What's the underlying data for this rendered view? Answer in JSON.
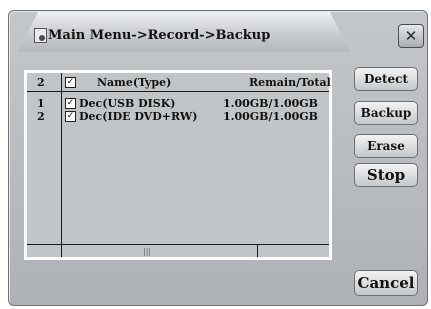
{
  "window": {
    "title": "Main Menu->Record->Backup",
    "close_label": "✕"
  },
  "list": {
    "header": {
      "count": "2",
      "name": "Name(Type)",
      "remain": "Remain/Total"
    },
    "rows": [
      {
        "index": "1",
        "checked": true,
        "name": "Dec(USB DISK)",
        "remain": "1.00GB/1.00GB"
      },
      {
        "index": "2",
        "checked": true,
        "name": "Dec(IDE DVD+RW)",
        "remain": "1.00GB/1.00GB"
      }
    ],
    "header_checked": true
  },
  "buttons": {
    "detect": "Detect",
    "backup": "Backup",
    "erase": "Erase",
    "stop": "Stop",
    "cancel": "Cancel"
  },
  "icons": {
    "title": "record-disk-icon",
    "close": "close-icon",
    "check": "checkmark-icon"
  }
}
